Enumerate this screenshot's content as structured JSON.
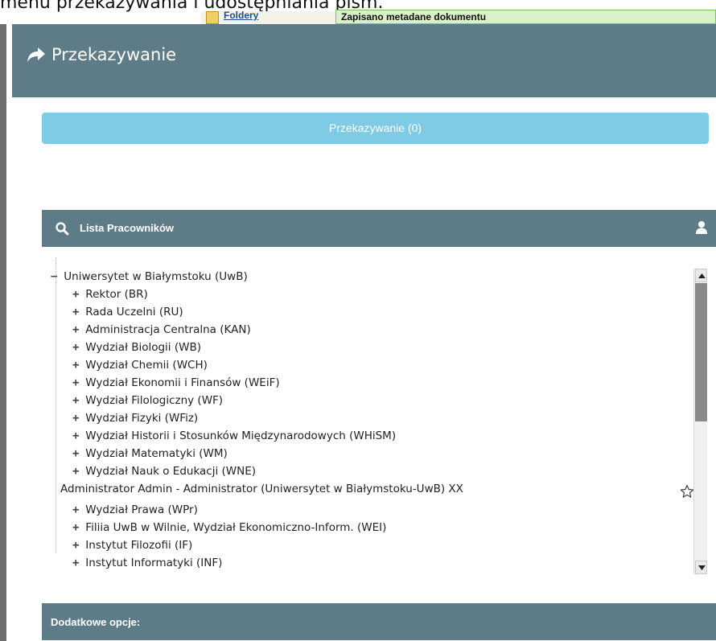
{
  "background": {
    "caption": "menu przekazywania i udostępniania pism.",
    "folders_link": "Foldery",
    "notice": "Zapisano metadane dokumentu"
  },
  "modal": {
    "title": "Przekazywanie",
    "title_icon": "share-arrow-icon",
    "forward_button_label": "Przekazywanie (0)"
  },
  "staff_panel": {
    "title": "Lista Pracowników",
    "left_icon": "search-icon",
    "right_icon": "user-icon"
  },
  "tree": {
    "root": {
      "toggle": "−",
      "label": "Uniwersytet w Białymstoku (UwB)"
    },
    "children": [
      {
        "toggle": "+",
        "label": "Rektor (BR)"
      },
      {
        "toggle": "+",
        "label": "Rada Uczelni (RU)"
      },
      {
        "toggle": "+",
        "label": "Administracja Centralna (KAN)"
      },
      {
        "toggle": "+",
        "label": "Wydział Biologii (WB)"
      },
      {
        "toggle": "+",
        "label": "Wydział Chemii (WCH)"
      },
      {
        "toggle": "+",
        "label": "Wydział Ekonomii i Finansów (WEiF)"
      },
      {
        "toggle": "+",
        "label": "Wydział Filologiczny (WF)"
      },
      {
        "toggle": "+",
        "label": "Wydział Fizyki (WFiz)"
      },
      {
        "toggle": "+",
        "label": "Wydział Historii i Stosunków Międzynarodowych (WHiSM)"
      },
      {
        "toggle": "+",
        "label": "Wydział Matematyki (WM)"
      },
      {
        "toggle": "+",
        "label": "Wydział Nauk o Edukacji (WNE)"
      }
    ],
    "employee": {
      "label": "Administrator Admin - Administrator (Uniwersytet w Białymstoku-UwB) XX",
      "icon": "star-icon"
    },
    "children_after": [
      {
        "toggle": "+",
        "label": "Wydział Prawa (WPr)"
      },
      {
        "toggle": "+",
        "label": "Filiia UwB w Wilnie, Wydział Ekonomiczno-Inform. (WEI)"
      },
      {
        "toggle": "+",
        "label": "Instytut Filozofii (IF)"
      },
      {
        "toggle": "+",
        "label": "Instytut Informatyki (INF)"
      }
    ]
  },
  "options_panel": {
    "title": "Dodatkowe opcje:"
  },
  "colors": {
    "header": "#5d7c88",
    "forward_button": "#7fcbe6"
  }
}
